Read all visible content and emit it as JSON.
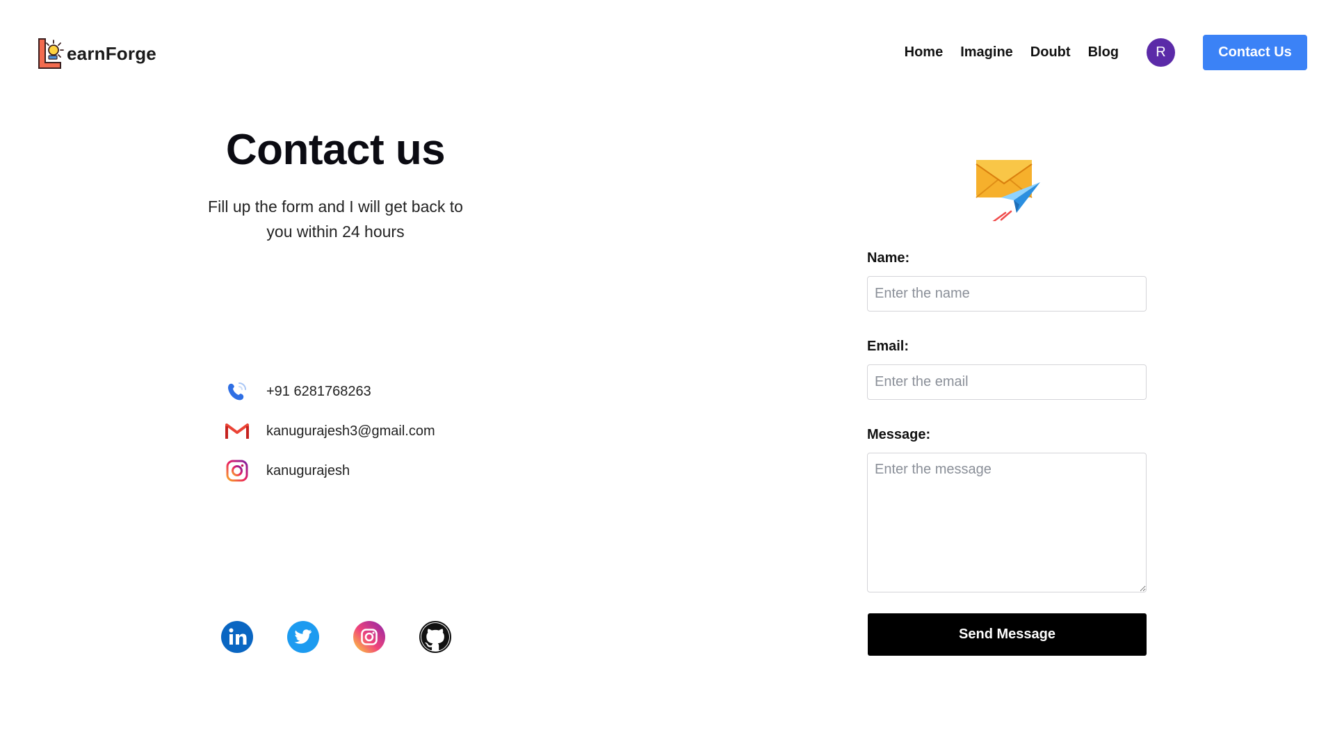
{
  "brand": {
    "name": "earnForge"
  },
  "nav": {
    "links": [
      "Home",
      "Imagine",
      "Doubt",
      "Blog"
    ],
    "avatar_initial": "R",
    "cta_label": "Contact Us"
  },
  "hero": {
    "title": "Contact us",
    "subtitle": "Fill up the form and I will get back to you within 24 hours"
  },
  "contacts": {
    "phone": "+91 6281768263",
    "email": "kanugurajesh3@gmail.com",
    "instagram": "kanugurajesh"
  },
  "socials": [
    "linkedin-icon",
    "twitter-icon",
    "instagram-icon",
    "github-icon"
  ],
  "form": {
    "name_label": "Name:",
    "name_placeholder": "Enter the name",
    "email_label": "Email:",
    "email_placeholder": "Enter the email",
    "message_label": "Message:",
    "message_placeholder": "Enter the message",
    "submit_label": "Send Message"
  },
  "colors": {
    "cta": "#3b82f6",
    "avatar": "#5b2aa8",
    "submit": "#000000"
  }
}
